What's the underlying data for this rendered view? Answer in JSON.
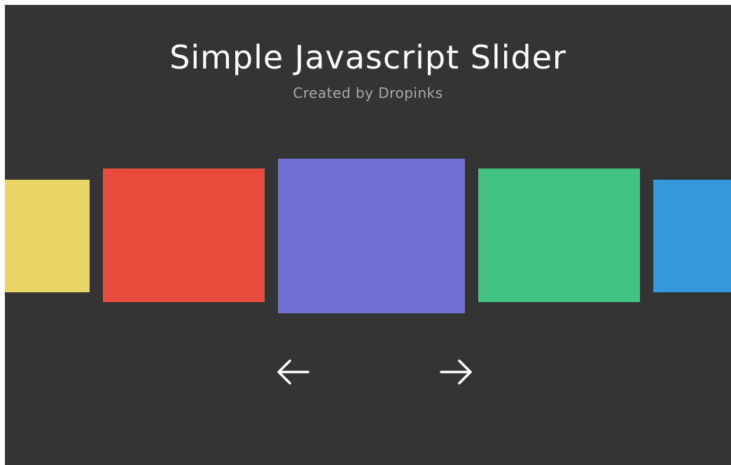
{
  "header": {
    "title": "Simple Javascript Slider",
    "subtitle": "Created by Dropinks"
  },
  "slides": [
    {
      "color": "#e9d466"
    },
    {
      "color": "#e74c3c"
    },
    {
      "color": "#706fd3"
    },
    {
      "color": "#42c383"
    },
    {
      "color": "#3498db"
    }
  ],
  "navigation": {
    "prev_icon": "arrow-left-icon",
    "next_icon": "arrow-right-icon"
  },
  "colors": {
    "background": "#343434",
    "title": "#ffffff",
    "subtitle": "#a9a9a9",
    "arrows": "#ffffff"
  }
}
